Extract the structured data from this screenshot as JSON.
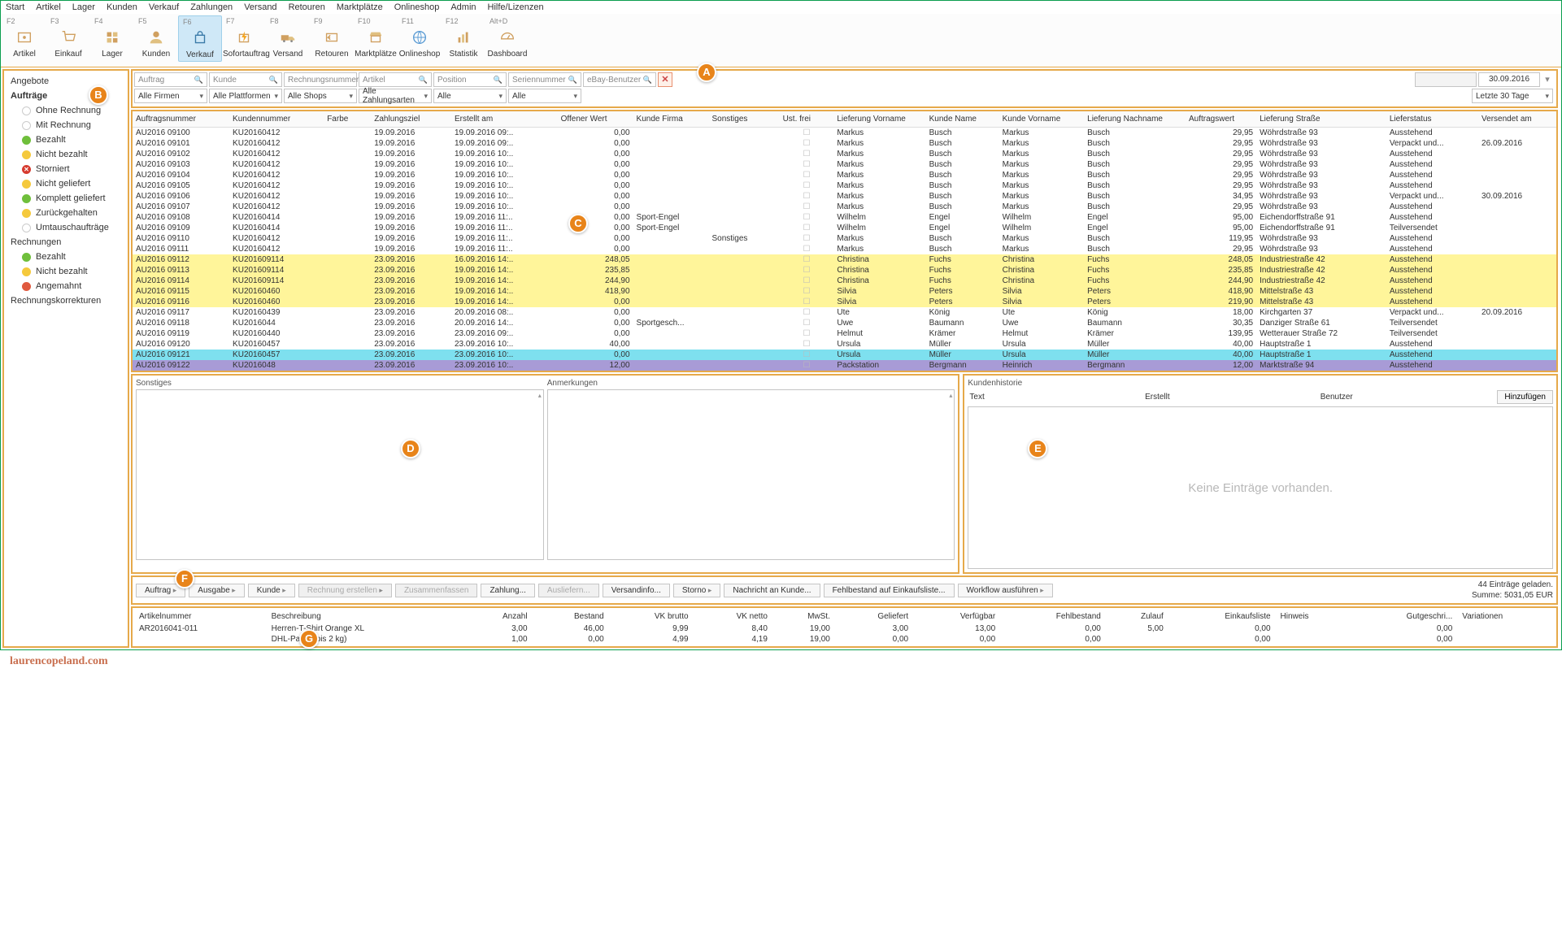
{
  "menubar": [
    "Start",
    "Artikel",
    "Lager",
    "Kunden",
    "Verkauf",
    "Zahlungen",
    "Versand",
    "Retouren",
    "Marktplätze",
    "Onlineshop",
    "Admin",
    "Hilfe/Lizenzen"
  ],
  "ribbon": [
    {
      "fkey": "F2",
      "label": "Artikel"
    },
    {
      "fkey": "F3",
      "label": "Einkauf"
    },
    {
      "fkey": "F4",
      "label": "Lager"
    },
    {
      "fkey": "F5",
      "label": "Kunden"
    },
    {
      "fkey": "F6",
      "label": "Verkauf",
      "active": true
    },
    {
      "fkey": "F7",
      "label": "Sofortauftrag"
    },
    {
      "fkey": "F8",
      "label": "Versand"
    },
    {
      "fkey": "F9",
      "label": "Retouren"
    },
    {
      "fkey": "F10",
      "label": "Marktplätze"
    },
    {
      "fkey": "F11",
      "label": "Onlineshop"
    },
    {
      "fkey": "F12",
      "label": "Statistik"
    },
    {
      "fkey": "Alt+D",
      "label": "Dashboard"
    }
  ],
  "sidebar": {
    "groups": [
      {
        "label": "Angebote",
        "bold": false
      },
      {
        "label": "Aufträge",
        "bold": true,
        "items": [
          {
            "label": "Ohne Rechnung",
            "color": "#ffffff",
            "border": "#ccc"
          },
          {
            "label": "Mit Rechnung",
            "color": "#ffffff",
            "border": "#ccc"
          },
          {
            "label": "Bezahlt",
            "color": "#6fbf3b"
          },
          {
            "label": "Nicht bezahlt",
            "color": "#f5c93c"
          },
          {
            "label": "Storniert",
            "kind": "x"
          },
          {
            "label": "Nicht geliefert",
            "color": "#f5c93c",
            "outline": true
          },
          {
            "label": "Komplett geliefert",
            "color": "#6fbf3b",
            "outline": true,
            "check": true
          },
          {
            "label": "Zurückgehalten",
            "color": "#f5c93c"
          },
          {
            "label": "Umtauschaufträge",
            "color": "#ffffff",
            "border": "#ccc"
          }
        ]
      },
      {
        "label": "Rechnungen",
        "bold": false,
        "items": [
          {
            "label": "Bezahlt",
            "color": "#6fbf3b"
          },
          {
            "label": "Nicht bezahlt",
            "color": "#f5c93c"
          },
          {
            "label": "Angemahnt",
            "color": "#e05a3f"
          }
        ]
      },
      {
        "label": "Rechnungskorrekturen",
        "bold": false,
        "icon": "doc"
      }
    ]
  },
  "filters": {
    "row1": [
      {
        "type": "search",
        "ph": "Auftrag"
      },
      {
        "type": "search",
        "ph": "Kunde"
      },
      {
        "type": "search",
        "ph": "Rechnungsnummer"
      },
      {
        "type": "search",
        "ph": "Artikel"
      },
      {
        "type": "search",
        "ph": "Position"
      },
      {
        "type": "search",
        "ph": "Seriennummer"
      },
      {
        "type": "search",
        "ph": "eBay-Benutzer"
      },
      {
        "type": "clear"
      }
    ],
    "row2": [
      {
        "type": "combo",
        "val": "Alle Firmen"
      },
      {
        "type": "combo",
        "val": "Alle Plattformen"
      },
      {
        "type": "combo",
        "val": "Alle Shops"
      },
      {
        "type": "combo",
        "val": "Alle Zahlungsarten"
      },
      {
        "type": "combo",
        "val": "Alle"
      },
      {
        "type": "combo",
        "val": "Alle"
      }
    ],
    "date_to": "30.09.2016",
    "period": "Letzte 30 Tage"
  },
  "columns": [
    "Auftragsnummer",
    "Kundennummer",
    "Farbe",
    "Zahlungsziel",
    "Erstellt am",
    "Offener Wert",
    "Kunde Firma",
    "Sonstiges",
    "Ust. frei",
    "Lieferung Vorname",
    "Kunde Name",
    "Kunde Vorname",
    "Lieferung Nachname",
    "Auftragswert",
    "Lieferung Straße",
    "Lieferstatus",
    "Versendet am"
  ],
  "rows": [
    {
      "a": "AU2016 09100",
      "k": "KU20160412",
      "z": "19.09.2016",
      "e": "19.09.2016 09:..",
      "o": "0,00",
      "vf": "Markus",
      "kn": "Busch",
      "kv": "Markus",
      "ln": "Busch",
      "aw": "29,95",
      "st": "Wöhrdstraße 93",
      "ls": "Ausstehend"
    },
    {
      "a": "AU2016 09101",
      "k": "KU20160412",
      "z": "19.09.2016",
      "e": "19.09.2016 09:..",
      "o": "0,00",
      "vf": "Markus",
      "kn": "Busch",
      "kv": "Markus",
      "ln": "Busch",
      "aw": "29,95",
      "st": "Wöhrdstraße 93",
      "ls": "Verpackt und...",
      "va": "26.09.2016"
    },
    {
      "a": "AU2016 09102",
      "k": "KU20160412",
      "z": "19.09.2016",
      "e": "19.09.2016 10:..",
      "o": "0,00",
      "vf": "Markus",
      "kn": "Busch",
      "kv": "Markus",
      "ln": "Busch",
      "aw": "29,95",
      "st": "Wöhrdstraße 93",
      "ls": "Ausstehend"
    },
    {
      "a": "AU2016 09103",
      "k": "KU20160412",
      "z": "19.09.2016",
      "e": "19.09.2016 10:..",
      "o": "0,00",
      "vf": "Markus",
      "kn": "Busch",
      "kv": "Markus",
      "ln": "Busch",
      "aw": "29,95",
      "st": "Wöhrdstraße 93",
      "ls": "Ausstehend"
    },
    {
      "a": "AU2016 09104",
      "k": "KU20160412",
      "z": "19.09.2016",
      "e": "19.09.2016 10:..",
      "o": "0,00",
      "vf": "Markus",
      "kn": "Busch",
      "kv": "Markus",
      "ln": "Busch",
      "aw": "29,95",
      "st": "Wöhrdstraße 93",
      "ls": "Ausstehend"
    },
    {
      "a": "AU2016 09105",
      "k": "KU20160412",
      "z": "19.09.2016",
      "e": "19.09.2016 10:..",
      "o": "0,00",
      "vf": "Markus",
      "kn": "Busch",
      "kv": "Markus",
      "ln": "Busch",
      "aw": "29,95",
      "st": "Wöhrdstraße 93",
      "ls": "Ausstehend"
    },
    {
      "a": "AU2016 09106",
      "k": "KU20160412",
      "z": "19.09.2016",
      "e": "19.09.2016 10:..",
      "o": "0,00",
      "vf": "Markus",
      "kn": "Busch",
      "kv": "Markus",
      "ln": "Busch",
      "aw": "34,95",
      "st": "Wöhrdstraße 93",
      "ls": "Verpackt und...",
      "va": "30.09.2016"
    },
    {
      "a": "AU2016 09107",
      "k": "KU20160412",
      "z": "19.09.2016",
      "e": "19.09.2016 10:..",
      "o": "0,00",
      "vf": "Markus",
      "kn": "Busch",
      "kv": "Markus",
      "ln": "Busch",
      "aw": "29,95",
      "st": "Wöhrdstraße 93",
      "ls": "Ausstehend"
    },
    {
      "a": "AU2016 09108",
      "k": "KU20160414",
      "z": "19.09.2016",
      "e": "19.09.2016 11:..",
      "o": "0,00",
      "kf": "Sport-Engel",
      "vf": "Wilhelm",
      "kn": "Engel",
      "kv": "Wilhelm",
      "ln": "Engel",
      "aw": "95,00",
      "st": "Eichendorffstraße 91",
      "ls": "Ausstehend"
    },
    {
      "a": "AU2016 09109",
      "k": "KU20160414",
      "z": "19.09.2016",
      "e": "19.09.2016 11:..",
      "o": "0,00",
      "kf": "Sport-Engel",
      "vf": "Wilhelm",
      "kn": "Engel",
      "kv": "Wilhelm",
      "ln": "Engel",
      "aw": "95,00",
      "st": "Eichendorffstraße 91",
      "ls": "Teilversendet"
    },
    {
      "a": "AU2016 09110",
      "k": "KU20160412",
      "z": "19.09.2016",
      "e": "19.09.2016 11:..",
      "o": "0,00",
      "so": "Sonstiges",
      "vf": "Markus",
      "kn": "Busch",
      "kv": "Markus",
      "ln": "Busch",
      "aw": "119,95",
      "st": "Wöhrdstraße 93",
      "ls": "Ausstehend"
    },
    {
      "a": "AU2016 09111",
      "k": "KU20160412",
      "z": "19.09.2016",
      "e": "19.09.2016 11:..",
      "o": "0,00",
      "vf": "Markus",
      "kn": "Busch",
      "kv": "Markus",
      "ln": "Busch",
      "aw": "29,95",
      "st": "Wöhrdstraße 93",
      "ls": "Ausstehend"
    },
    {
      "a": "AU2016 09112",
      "k": "KU201609114",
      "z": "23.09.2016",
      "e": "16.09.2016 14:..",
      "o": "248,05",
      "vf": "Christina",
      "kn": "Fuchs",
      "kv": "Christina",
      "ln": "Fuchs",
      "aw": "248,05",
      "st": "Industriestraße 42",
      "ls": "Ausstehend",
      "hl": "yellow"
    },
    {
      "a": "AU2016 09113",
      "k": "KU201609114",
      "z": "23.09.2016",
      "e": "19.09.2016 14:..",
      "o": "235,85",
      "vf": "Christina",
      "kn": "Fuchs",
      "kv": "Christina",
      "ln": "Fuchs",
      "aw": "235,85",
      "st": "Industriestraße 42",
      "ls": "Ausstehend",
      "hl": "yellow"
    },
    {
      "a": "AU2016 09114",
      "k": "KU201609114",
      "z": "23.09.2016",
      "e": "19.09.2016 14:..",
      "o": "244,90",
      "vf": "Christina",
      "kn": "Fuchs",
      "kv": "Christina",
      "ln": "Fuchs",
      "aw": "244,90",
      "st": "Industriestraße 42",
      "ls": "Ausstehend",
      "hl": "yellow"
    },
    {
      "a": "AU2016 09115",
      "k": "KU20160460",
      "z": "23.09.2016",
      "e": "19.09.2016 14:..",
      "o": "418,90",
      "vf": "Silvia",
      "kn": "Peters",
      "kv": "Silvia",
      "ln": "Peters",
      "aw": "418,90",
      "st": "Mittelstraße 43",
      "ls": "Ausstehend",
      "hl": "yellow"
    },
    {
      "a": "AU2016 09116",
      "k": "KU20160460",
      "z": "23.09.2016",
      "e": "19.09.2016 14:..",
      "o": "0,00",
      "vf": "Silvia",
      "kn": "Peters",
      "kv": "Silvia",
      "ln": "Peters",
      "aw": "219,90",
      "st": "Mittelstraße 43",
      "ls": "Ausstehend",
      "hl": "yellow"
    },
    {
      "a": "AU2016 09117",
      "k": "KU20160439",
      "z": "23.09.2016",
      "e": "20.09.2016 08:..",
      "o": "0,00",
      "vf": "Ute",
      "kn": "König",
      "kv": "Ute",
      "ln": "König",
      "aw": "18,00",
      "st": "Kirchgarten 37",
      "ls": "Verpackt und...",
      "va": "20.09.2016"
    },
    {
      "a": "AU2016 09118",
      "k": "KU2016044",
      "z": "23.09.2016",
      "e": "20.09.2016 14:..",
      "o": "0,00",
      "kf": "Sportgesch...",
      "vf": "Uwe",
      "kn": "Baumann",
      "kv": "Uwe",
      "ln": "Baumann",
      "aw": "30,35",
      "st": "Danziger Straße 61",
      "ls": "Teilversendet"
    },
    {
      "a": "AU2016 09119",
      "k": "KU20160440",
      "z": "23.09.2016",
      "e": "23.09.2016 09:..",
      "o": "0,00",
      "vf": "Helmut",
      "kn": "Krämer",
      "kv": "Helmut",
      "ln": "Krämer",
      "aw": "139,95",
      "st": "Wetterauer Straße 72",
      "ls": "Teilversendet"
    },
    {
      "a": "AU2016 09120",
      "k": "KU20160457",
      "z": "23.09.2016",
      "e": "23.09.2016 10:..",
      "o": "40,00",
      "vf": "Ursula",
      "kn": "Müller",
      "kv": "Ursula",
      "ln": "Müller",
      "aw": "40,00",
      "st": "Hauptstraße 1",
      "ls": "Ausstehend"
    },
    {
      "a": "AU2016 09121",
      "k": "KU20160457",
      "z": "23.09.2016",
      "e": "23.09.2016 10:..",
      "o": "0,00",
      "vf": "Ursula",
      "kn": "Müller",
      "kv": "Ursula",
      "ln": "Müller",
      "aw": "40,00",
      "st": "Hauptstraße 1",
      "ls": "Ausstehend",
      "hl": "cyan"
    },
    {
      "a": "AU2016 09122",
      "k": "KU2016048",
      "z": "23.09.2016",
      "e": "23.09.2016 10:..",
      "o": "12,00",
      "vf": "Packstation",
      "kn": "Bergmann",
      "kv": "Heinrich",
      "ln": "Bergmann",
      "aw": "12,00",
      "st": "Marktstraße 94",
      "ls": "Ausstehend",
      "hl": "violet"
    }
  ],
  "panes": {
    "left": [
      "Sonstiges",
      "Anmerkungen"
    ],
    "right": {
      "title": "Kundenhistorie",
      "cols": [
        "Text",
        "Erstellt",
        "Benutzer"
      ],
      "add": "Hinzufügen",
      "empty": "Keine Einträge vorhanden."
    }
  },
  "actions": {
    "buttons": [
      {
        "label": "Auftrag",
        "menu": true
      },
      {
        "label": "Ausgabe",
        "menu": true
      },
      {
        "label": "Kunde",
        "menu": true
      },
      {
        "label": "Rechnung erstellen",
        "menu": true,
        "disabled": true
      },
      {
        "label": "Zusammenfassen",
        "disabled": true
      },
      {
        "label": "Zahlung..."
      },
      {
        "label": "Ausliefern...",
        "disabled": true
      },
      {
        "label": "Versandinfo..."
      },
      {
        "label": "Storno",
        "menu": true
      },
      {
        "label": "Nachricht an Kunde..."
      },
      {
        "label": "Fehlbestand auf Einkaufsliste..."
      },
      {
        "label": "Workflow ausführen",
        "menu": true
      }
    ],
    "summary1": "44 Einträge geladen.",
    "summary2": "Summe: 5031,05 EUR"
  },
  "detail": {
    "cols": [
      "Artikelnummer",
      "Beschreibung",
      "Anzahl",
      "Bestand",
      "VK brutto",
      "VK netto",
      "MwSt.",
      "Geliefert",
      "Verfügbar",
      "Fehlbestand",
      "Zulauf",
      "Einkaufsliste",
      "Hinweis",
      "Gutgeschri...",
      "Variationen"
    ],
    "rows": [
      {
        "an": "AR2016041-011",
        "b": "Herren-T-Shirt Orange XL",
        "az": "3,00",
        "bs": "46,00",
        "vb": "9,99",
        "vn": "8,40",
        "m": "19,00",
        "g": "3,00",
        "vf": "13,00",
        "fb": "0,00",
        "zu": "5,00",
        "ek": "0,00",
        "gu": "0,00"
      },
      {
        "an": "",
        "b": "DHL-Paket (bis 2 kg)",
        "az": "1,00",
        "bs": "0,00",
        "vb": "4,99",
        "vn": "4,19",
        "m": "19,00",
        "g": "0,00",
        "vf": "0,00",
        "fb": "0,00",
        "zu": "",
        "ek": "0,00",
        "gu": "0,00"
      }
    ]
  },
  "badges": [
    "A",
    "B",
    "C",
    "D",
    "E",
    "F",
    "G"
  ],
  "brand": "laurencopeland.com"
}
